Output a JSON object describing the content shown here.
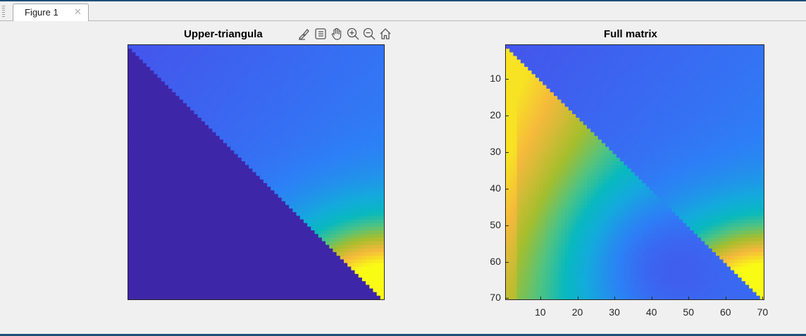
{
  "window": {
    "tab_label": "Figure 1",
    "close_glyph": "✕"
  },
  "axes_toolbar": {
    "icons": [
      "brush-icon",
      "datatip-icon",
      "pan-hand-icon",
      "zoom-in-icon",
      "zoom-out-icon",
      "home-icon"
    ]
  },
  "colormap": "parula",
  "chart_data": [
    {
      "type": "heatmap",
      "title": "Upper-triangular",
      "visible_title": "Upper-triangula",
      "matrix_size": [
        70,
        70
      ],
      "structure": "upper-triangular (entries below the diagonal are 0)",
      "x_ticks": [],
      "y_ticks": [],
      "color_range": [
        0,
        1
      ],
      "note_values": "normalized color values; diagonal rises from low (dark blue) at top-left to high (yellow) at bottom-right"
    },
    {
      "type": "heatmap",
      "title": "Full matrix",
      "matrix_size": [
        70,
        70
      ],
      "structure": "full matrix with distinct upper and lower triangles",
      "x_ticks": [
        10,
        20,
        30,
        40,
        50,
        60,
        70
      ],
      "y_ticks": [
        10,
        20,
        30,
        40,
        50,
        60,
        70
      ],
      "xlim": [
        0.5,
        70.5
      ],
      "ylim": [
        0.5,
        70.5
      ],
      "color_range": [
        0,
        1
      ]
    }
  ]
}
